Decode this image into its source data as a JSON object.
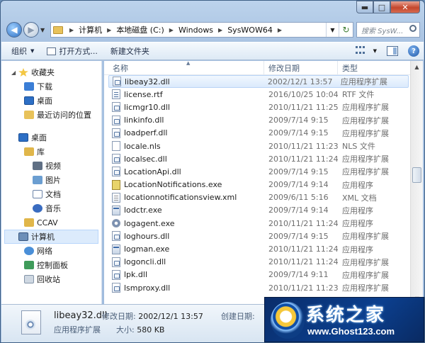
{
  "window": {
    "controls": {
      "minimize": "▬",
      "maximize": "□",
      "close": "✕"
    }
  },
  "address": {
    "crumbs": [
      "计算机",
      "本地磁盘 (C:)",
      "Windows",
      "SysWOW64"
    ],
    "search_placeholder": "搜索 SysW..."
  },
  "toolbar": {
    "organize": "组织",
    "open_with": "打开方式...",
    "new_folder": "新建文件夹"
  },
  "nav": {
    "items": [
      {
        "label": "收藏夹",
        "icon": "star-icon"
      },
      {
        "label": "下载",
        "icon": "download-icon"
      },
      {
        "label": "桌面",
        "icon": "desktop-icon"
      },
      {
        "label": "最近访问的位置",
        "icon": "recent-places-icon"
      },
      {
        "label": "桌面",
        "icon": "desktop-icon"
      },
      {
        "label": "库",
        "icon": "library-icon"
      },
      {
        "label": "视频",
        "icon": "video-icon"
      },
      {
        "label": "图片",
        "icon": "picture-icon"
      },
      {
        "label": "文档",
        "icon": "document-icon"
      },
      {
        "label": "音乐",
        "icon": "music-icon"
      },
      {
        "label": "CCAV",
        "icon": "folder-icon"
      },
      {
        "label": "计算机",
        "icon": "computer-icon"
      },
      {
        "label": "网络",
        "icon": "network-icon"
      },
      {
        "label": "控制面板",
        "icon": "control-panel-icon"
      },
      {
        "label": "回收站",
        "icon": "recycle-bin-icon"
      }
    ]
  },
  "columns": {
    "name": "名称",
    "date": "修改日期",
    "type": "类型"
  },
  "files": [
    {
      "name": "libeay32.dll",
      "date": "2002/12/1 13:57",
      "type": "应用程序扩展"
    },
    {
      "name": "license.rtf",
      "date": "2016/10/25 10:04",
      "type": "RTF 文件"
    },
    {
      "name": "licmgr10.dll",
      "date": "2010/11/21 11:25",
      "type": "应用程序扩展"
    },
    {
      "name": "linkinfo.dll",
      "date": "2009/7/14 9:15",
      "type": "应用程序扩展"
    },
    {
      "name": "loadperf.dll",
      "date": "2009/7/14 9:15",
      "type": "应用程序扩展"
    },
    {
      "name": "locale.nls",
      "date": "2010/11/21 11:23",
      "type": "NLS 文件"
    },
    {
      "name": "localsec.dll",
      "date": "2010/11/21 11:24",
      "type": "应用程序扩展"
    },
    {
      "name": "LocationApi.dll",
      "date": "2009/7/14 9:15",
      "type": "应用程序扩展"
    },
    {
      "name": "LocationNotifications.exe",
      "date": "2009/7/14 9:14",
      "type": "应用程序"
    },
    {
      "name": "locationnotificationsview.xml",
      "date": "2009/6/11 5:16",
      "type": "XML 文档"
    },
    {
      "name": "lodctr.exe",
      "date": "2009/7/14 9:14",
      "type": "应用程序"
    },
    {
      "name": "logagent.exe",
      "date": "2010/11/21 11:24",
      "type": "应用程序"
    },
    {
      "name": "loghours.dll",
      "date": "2009/7/14 9:15",
      "type": "应用程序扩展"
    },
    {
      "name": "logman.exe",
      "date": "2010/11/21 11:24",
      "type": "应用程序"
    },
    {
      "name": "logoncli.dll",
      "date": "2010/11/21 11:24",
      "type": "应用程序扩展"
    },
    {
      "name": "lpk.dll",
      "date": "2009/7/14 9:11",
      "type": "应用程序扩展"
    },
    {
      "name": "lsmproxy.dll",
      "date": "2010/11/21 11:23",
      "type": "应用程序扩展"
    }
  ],
  "status": {
    "name": "libeay32.dll",
    "type": "应用程序扩展",
    "modified_label": "修改日期:",
    "modified_value": "2002/12/1 13:57",
    "size_label": "大小:",
    "size_value": "580 KB",
    "created_label": "创建日期:"
  },
  "watermark": {
    "title": "系统之家",
    "url": "www.Ghost123.com"
  }
}
